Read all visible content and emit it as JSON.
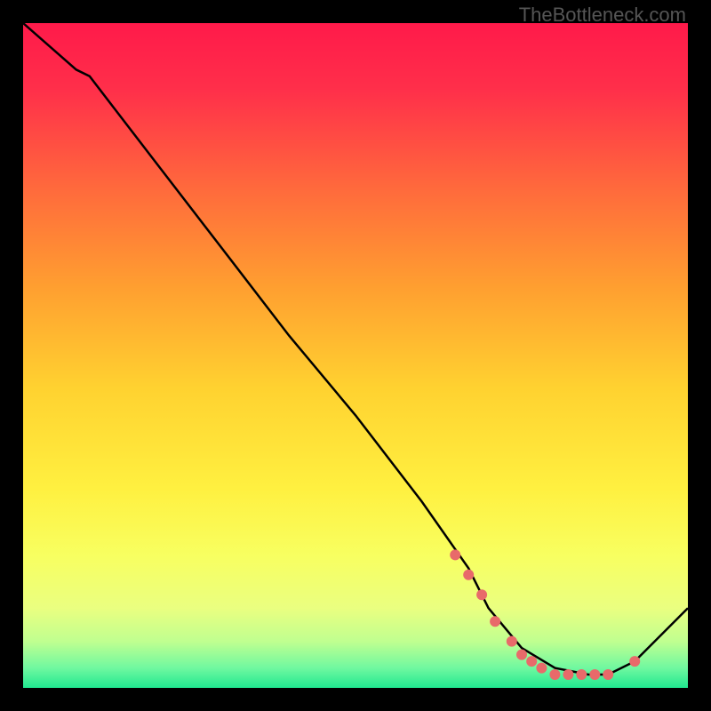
{
  "watermark": "TheBottleneck.com",
  "chart_data": {
    "type": "line",
    "title": "",
    "xlabel": "",
    "ylabel": "",
    "xlim": [
      0,
      100
    ],
    "ylim": [
      0,
      100
    ],
    "curve": {
      "x": [
        0,
        8,
        10,
        20,
        30,
        40,
        50,
        60,
        67,
        70,
        75,
        80,
        85,
        88,
        92,
        100
      ],
      "y": [
        100,
        93,
        92,
        79,
        66,
        53,
        41,
        28,
        18,
        12,
        6,
        3,
        2,
        2,
        4,
        12
      ]
    },
    "markers": {
      "x": [
        65,
        67,
        69,
        71,
        73.5,
        75,
        76.5,
        78,
        80,
        82,
        84,
        86,
        88,
        92
      ],
      "y": [
        20,
        17,
        14,
        10,
        7,
        5,
        4,
        3,
        2,
        2,
        2,
        2,
        2,
        4
      ]
    },
    "gradient_stops": [
      {
        "offset": 0.0,
        "color": "#ff1a4a"
      },
      {
        "offset": 0.1,
        "color": "#ff2f4a"
      },
      {
        "offset": 0.25,
        "color": "#ff6a3c"
      },
      {
        "offset": 0.4,
        "color": "#ffa030"
      },
      {
        "offset": 0.55,
        "color": "#ffd230"
      },
      {
        "offset": 0.7,
        "color": "#fff040"
      },
      {
        "offset": 0.8,
        "color": "#f8ff60"
      },
      {
        "offset": 0.88,
        "color": "#eaff80"
      },
      {
        "offset": 0.93,
        "color": "#c0ff90"
      },
      {
        "offset": 0.97,
        "color": "#70f8a0"
      },
      {
        "offset": 1.0,
        "color": "#20e890"
      }
    ],
    "marker_color": "#e86a6a",
    "curve_color": "#000000"
  }
}
